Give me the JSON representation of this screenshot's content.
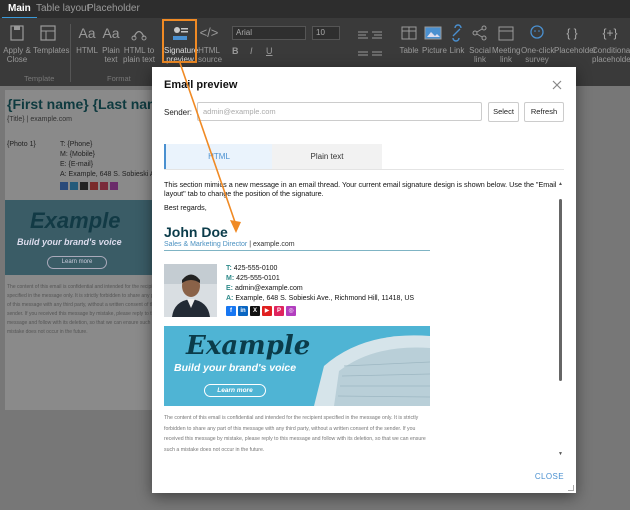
{
  "tabs": [
    "Main",
    "Table layout",
    "Placeholder"
  ],
  "ribbon": {
    "apply_close": "Apply &\nClose",
    "templates": "Templates",
    "html": "HTML",
    "plain_text": "Plain\ntext",
    "html_to_plain": "HTML to\nplain text",
    "signature_preview": "Signature\npreview",
    "html_source": "HTML\nsource",
    "font": "Arial",
    "font_size": "10",
    "table": "Table",
    "picture": "Picture",
    "link": "Link",
    "social_link": "Social\nlink",
    "meeting_link": "Meeting\nlink",
    "one_click_survey": "One-click\nsurvey",
    "placeholder": "Placeholder",
    "conditional_placeholder": "Conditional\nplaceholder",
    "group_template": "Template",
    "group_format": "Format",
    "accent": "#f08a24"
  },
  "background_signature": {
    "name": "{First name} {Last name}",
    "title": "{Title} | example.com",
    "photo": "{Photo 1}",
    "phone": "T: {Phone}",
    "mobile": "M: {Mobile}",
    "email": "E: {E-mail}",
    "address": "A: Example, 648 S. Sobieski Ave., Richmond Hill, 11418, US",
    "banner_brand": "Example",
    "banner_tagline": "Build your brand's voice",
    "banner_button": "Learn more",
    "disclaimer": "The content of this email is confidential and intended for the recipient specified in the message only. It is strictly forbidden to share any part of this message with any third party, without a written consent of the sender. If you received this message by mistake, please reply to this message and follow with its deletion, so that we can ensure such a mistake does not occur in the future."
  },
  "modal": {
    "title": "Email preview",
    "sender_label": "Sender:",
    "sender_placeholder": "admin@example.com",
    "select_button": "Select",
    "refresh_button": "Refresh",
    "tab_html": "HTML",
    "tab_plain": "Plain text",
    "close_link": "CLOSE",
    "preview": {
      "intro": "This section mimics a new message in an email thread. Your current email signature design is shown below. Use the \"Email layout\" tab to change the position of the signature.",
      "regards": "Best regards,",
      "name": "John Doe",
      "title": "Sales & Marketing Director",
      "site": "example.com",
      "phone_label": "T:",
      "phone": "425-555-0100",
      "mobile_label": "M:",
      "mobile": "425-555-0101",
      "email_label": "E:",
      "email": "admin@example.com",
      "address_label": "A:",
      "address": "Example, 648 S. Sobieski Ave., Richmond Hill, 11418, US",
      "social": [
        "f",
        "in",
        "X",
        "▶",
        "P",
        "◎"
      ],
      "banner_brand": "Example",
      "banner_tagline": "Build your brand's voice",
      "banner_button": "Learn more",
      "disclaimer": "The content of this email is confidential and intended for the recipient specified in the message only. It is strictly forbidden to share any part of this message with any third party, without a written consent of the sender. If you received this message by mistake, please reply to this message and follow with its deletion, so that we can ensure such a mistake does not occur in the future."
    }
  }
}
